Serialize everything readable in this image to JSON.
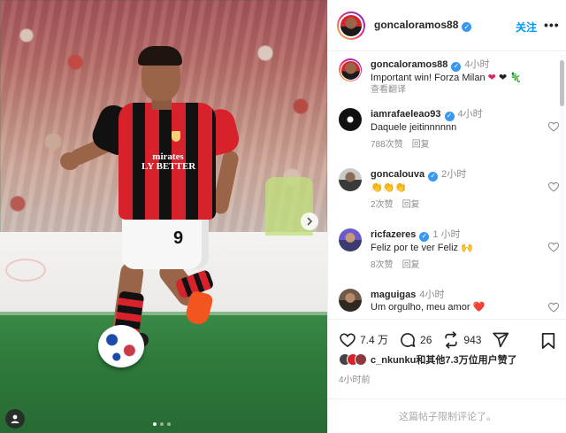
{
  "post": {
    "author": "goncaloramos88",
    "follow_label": "关注",
    "more_label": "•••",
    "caption_time": "4小时",
    "caption_text": "Important win! Forza Milan",
    "translate_label": "查看翻译",
    "carousel": {
      "current_slide": 1,
      "total_slides": 3
    }
  },
  "photo": {
    "sponsor_text": "mirates\nLY BETTER",
    "shorts_number": "9"
  },
  "comments": [
    {
      "user": "iamrafaeleao93",
      "time": "4小时",
      "text": "Daquele jeitinnnnnn",
      "likes": "788次赞",
      "reply": "回复"
    },
    {
      "user": "goncalouva",
      "time": "2小时",
      "text": "👏👏👏",
      "likes": "2次赞",
      "reply": "回复"
    },
    {
      "user": "ricfazeres",
      "time": "1 小时",
      "text": "Feliz por te ver Feliz 🙌",
      "likes": "8次赞",
      "reply": "回复"
    },
    {
      "user": "maguigas",
      "time": "4小时",
      "text": "Um orgulho, meu amor ❤️",
      "likes": "",
      "reply": ""
    }
  ],
  "actions": {
    "likes_count": "7.4 万",
    "comments_count": "26",
    "reposts_count": "943"
  },
  "liked_by_text": "c_nkunku和其他7.3万位用户赞了",
  "posted_time": "4小时前",
  "restricted_text": "这篇帖子限制评论了。",
  "colors": {
    "accent": "#0095f6",
    "verified": "#3897f0",
    "heart": "#ed4956",
    "milan_red": "#d7222b"
  }
}
